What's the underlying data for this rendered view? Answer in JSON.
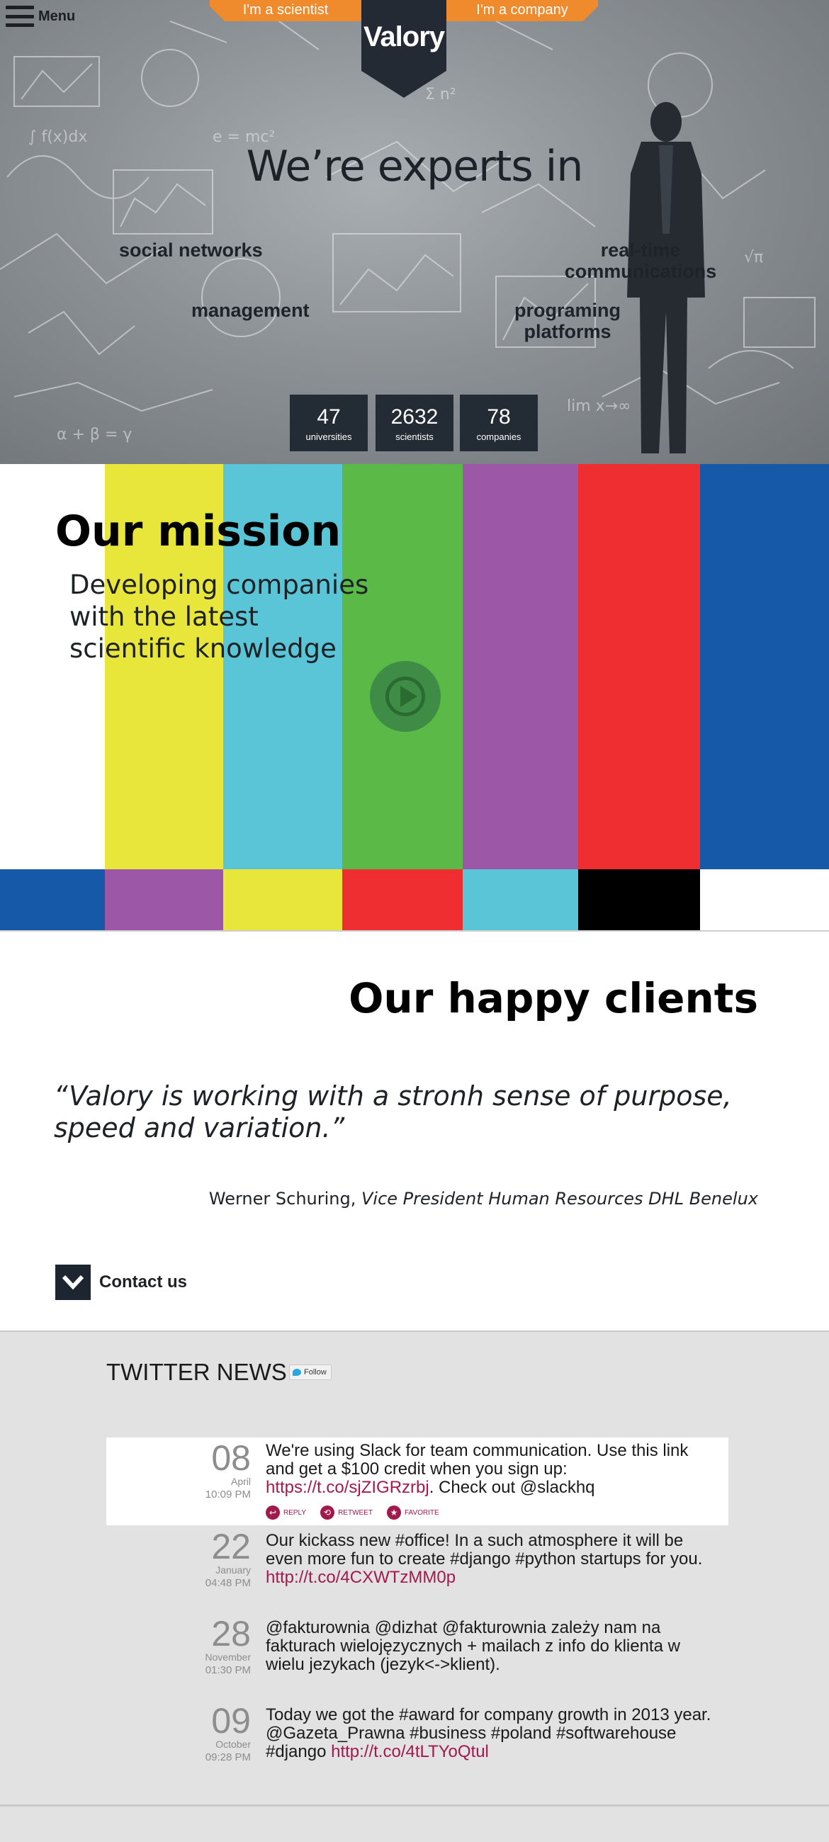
{
  "nav": {
    "menu_label": "Menu",
    "tab_scientist": "I'm a scientist",
    "tab_company": "I'm a company",
    "logo_text": "Valory"
  },
  "hero": {
    "title": "We’re experts in",
    "keywords": {
      "social_networks": "social networks",
      "management": "management",
      "realtime_1": "real-time",
      "realtime_2": "communications",
      "platforms_1": "programing",
      "platforms_2": "platforms"
    },
    "stats": [
      {
        "value": "47",
        "label": "universities"
      },
      {
        "value": "2632",
        "label": "scientists"
      },
      {
        "value": "78",
        "label": "companies"
      }
    ]
  },
  "mission": {
    "heading": "Our mission",
    "subtitle": "Developing companies with the latest scientific knowledge",
    "colors": {
      "yellow": "#e8e63a",
      "cyan": "#5ac5d7",
      "green": "#5bb947",
      "purple": "#9c57a6",
      "red": "#ef2e32",
      "blue": "#1559a8",
      "black": "#000000",
      "white": "#ffffff"
    },
    "play_icon": "play-icon"
  },
  "clients": {
    "heading": "Our happy clients",
    "quote": "“Valory is working with a stronh sense of purpose, speed and variation.”",
    "author": "Werner Schuring,",
    "role": " Vice President Human Resources DHL Benelux",
    "contact_label": "Contact us"
  },
  "twitter": {
    "heading": "TWITTER NEWS",
    "follow_label": "Follow",
    "actions": {
      "reply": "REPLY",
      "retweet": "RETWEET",
      "favorite": "FAVORITE"
    },
    "tweets": [
      {
        "day": "08",
        "month": "April",
        "time": "10:09 PM",
        "text": "We're using Slack for team communication. Use this link and get a $100 credit when you sign up: ",
        "link": "https://t.co/sjZIGRzrbj",
        "text_after": ". Check out @slackhq"
      },
      {
        "day": "22",
        "month": "January",
        "time": "04:48 PM",
        "text": "Our kickass new #office! In a such atmosphere it will be even more fun to create #django #python startups for you. ",
        "link": "http://t.co/4CXWTzMM0p",
        "text_after": ""
      },
      {
        "day": "28",
        "month": "November",
        "time": "01:30 PM",
        "text": "@fakturownia @dizhat @fakturownia zależy nam na fakturach wielojęzycznych + mailach z info do klienta w wielu jezykach (jezyk<->klient).",
        "link": "",
        "text_after": ""
      },
      {
        "day": "09",
        "month": "October",
        "time": "09:28 PM",
        "text": "Today we got the #award for company growth in 2013 year. @Gazeta_Prawna #business #poland #softwarehouse #django ",
        "link": "http://t.co/4tLTYoQtul",
        "text_after": ""
      }
    ]
  }
}
